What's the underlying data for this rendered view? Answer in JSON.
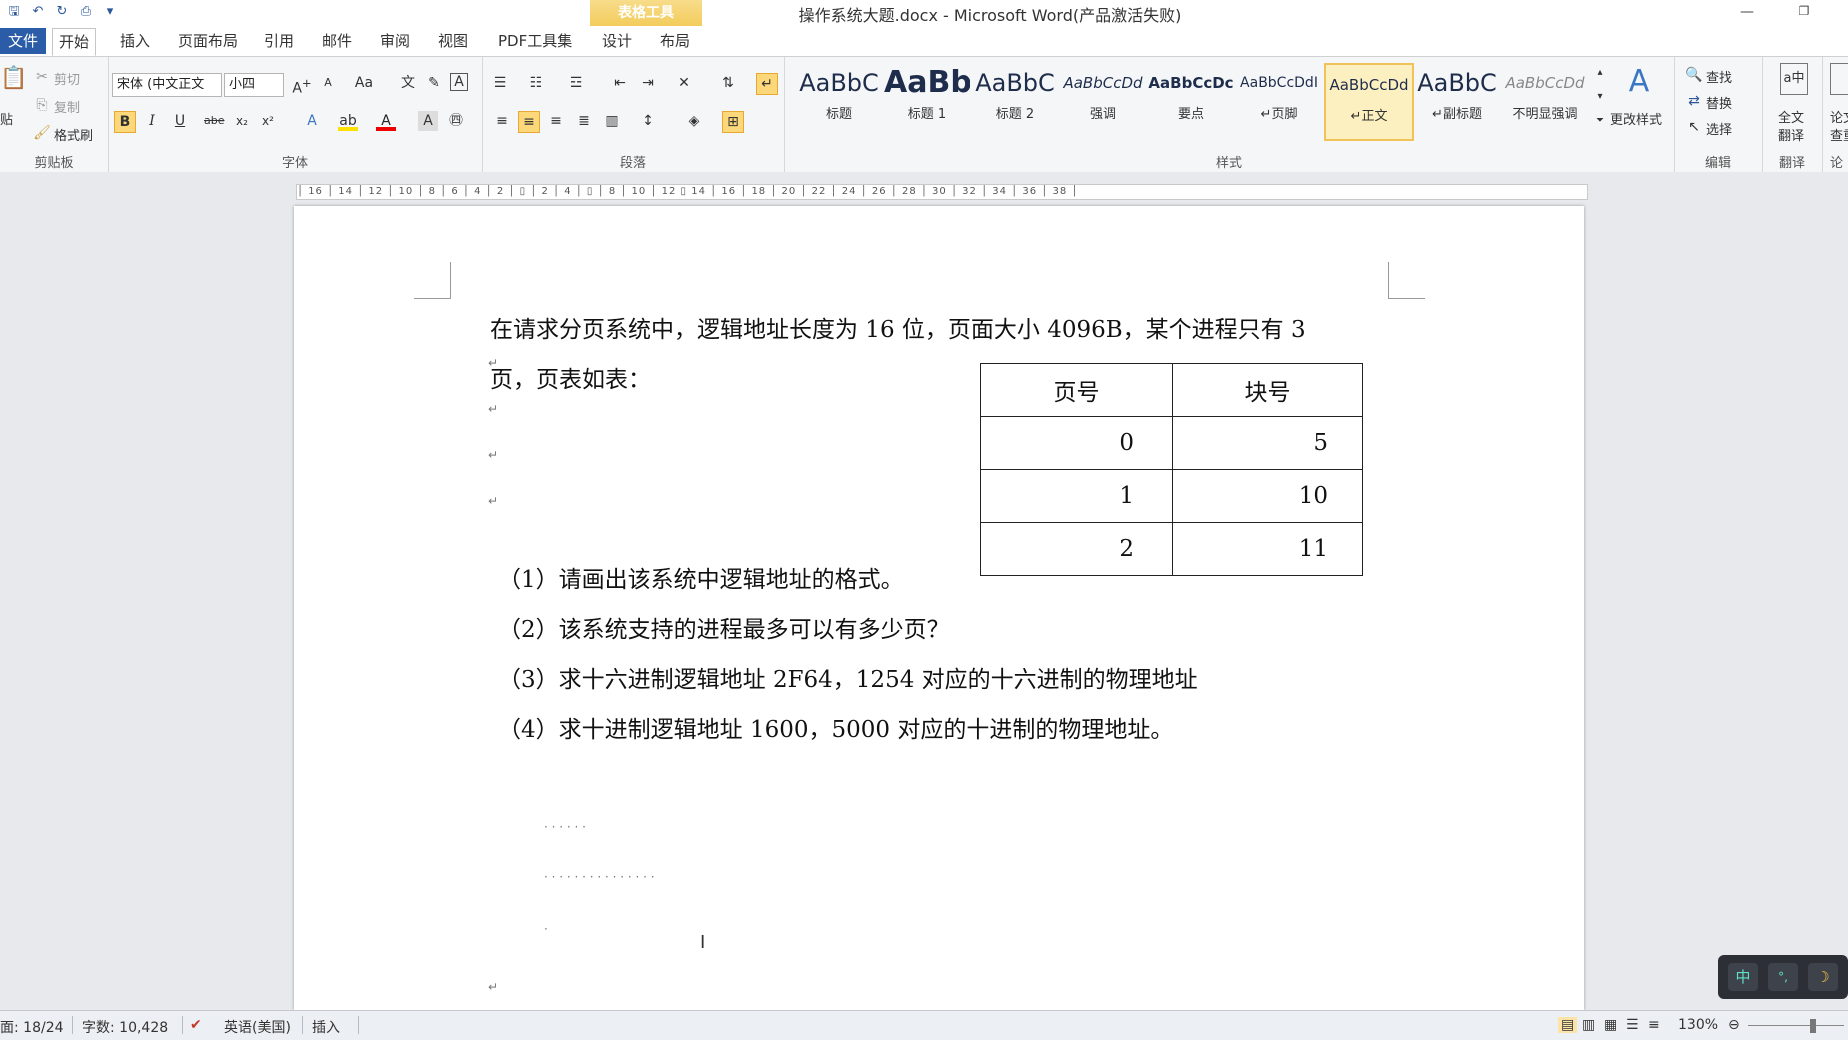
{
  "titlebar": {
    "context_tools": "表格工具",
    "doc_title": "操作系统大题.docx - Microsoft Word(产品激活失败)",
    "minimize": "—",
    "restore": "❐"
  },
  "tabs": {
    "file": "文件",
    "home": "开始",
    "insert": "插入",
    "layout": "页面布局",
    "references": "引用",
    "mailings": "邮件",
    "review": "审阅",
    "view": "视图",
    "pdf": "PDF工具集",
    "design": "设计",
    "table_layout": "布局"
  },
  "ribbon": {
    "clipboard": {
      "label": "剪贴板",
      "paste": "贴",
      "cut": "剪切",
      "copy": "复制",
      "format_painter": "格式刷"
    },
    "font": {
      "label": "字体",
      "font_name": "宋体 (中文正文",
      "font_size": "小四"
    },
    "paragraph": {
      "label": "段落"
    },
    "styles": {
      "label": "样式",
      "items": [
        {
          "sample": "AaBbC",
          "name": "标题"
        },
        {
          "sample": "AaBb",
          "name": "标题 1"
        },
        {
          "sample": "AaBbC",
          "name": "标题 2"
        },
        {
          "sample": "AaBbCcDd",
          "name": "强调"
        },
        {
          "sample": "AaBbCcDc",
          "name": "要点"
        },
        {
          "sample": "AaBbCcDdI",
          "name": "↵页脚"
        },
        {
          "sample": "AaBbCcDd",
          "name": "↵正文"
        },
        {
          "sample": "AaBbC",
          "name": "↵副标题"
        },
        {
          "sample": "AaBbCcDd",
          "name": "不明显强调"
        }
      ],
      "change_styles": "更改样式"
    },
    "editing": {
      "label": "编辑",
      "find": "查找",
      "replace": "替换",
      "select": "选择"
    },
    "translate": {
      "label": "翻译",
      "full_text": "全文",
      "translate": "翻译"
    },
    "paper": {
      "label": "论",
      "a": "论文",
      "b": "查重"
    }
  },
  "ruler": {
    "ticks": "│ 16 │ 14 │ 12 │ 10 │ 8 │ 6 │ 4 │ 2 │ ▯ │ 2 │ 4 │ ▯ │ 8 │ 10 │ 12 ▯ 14 │ 16 │ 18 │ 20 │ 22 │ 24 │ 26 │ 28 │ 30 │ 32 │ 34 │ 36 │ 38 │"
  },
  "document": {
    "line1": "在请求分页系统中，逻辑地址长度为 16 位，页面大小 4096B，某个进程只有 3",
    "line2": "页，页表如表：",
    "table": {
      "headers": [
        "页号",
        "块号"
      ],
      "rows": [
        [
          "0",
          "5"
        ],
        [
          "1",
          "10"
        ],
        [
          "2",
          "11"
        ]
      ]
    },
    "questions": [
      "（1）请画出该系统中逻辑地址的格式。",
      "（2）该系统支持的进程最多可以有多少页？",
      "（3）求十六进制逻辑地址 2F64，1254 对应的十六进制的物理地址",
      "（4）求十进制逻辑地址 1600，5000 对应的十进制的物理地址。"
    ],
    "dots1": "· · · · · ·",
    "dots2": "· · · · · · · · · · · · · · ·",
    "dots3": "·",
    "para_mark": "↵"
  },
  "statusbar": {
    "page": "面: 18/24",
    "words": "字数: 10,428",
    "language": "英语(美国)",
    "mode": "插入",
    "zoom": "130%"
  },
  "ime": {
    "cn": "中",
    "punct": "°,",
    "moon": "☽"
  }
}
